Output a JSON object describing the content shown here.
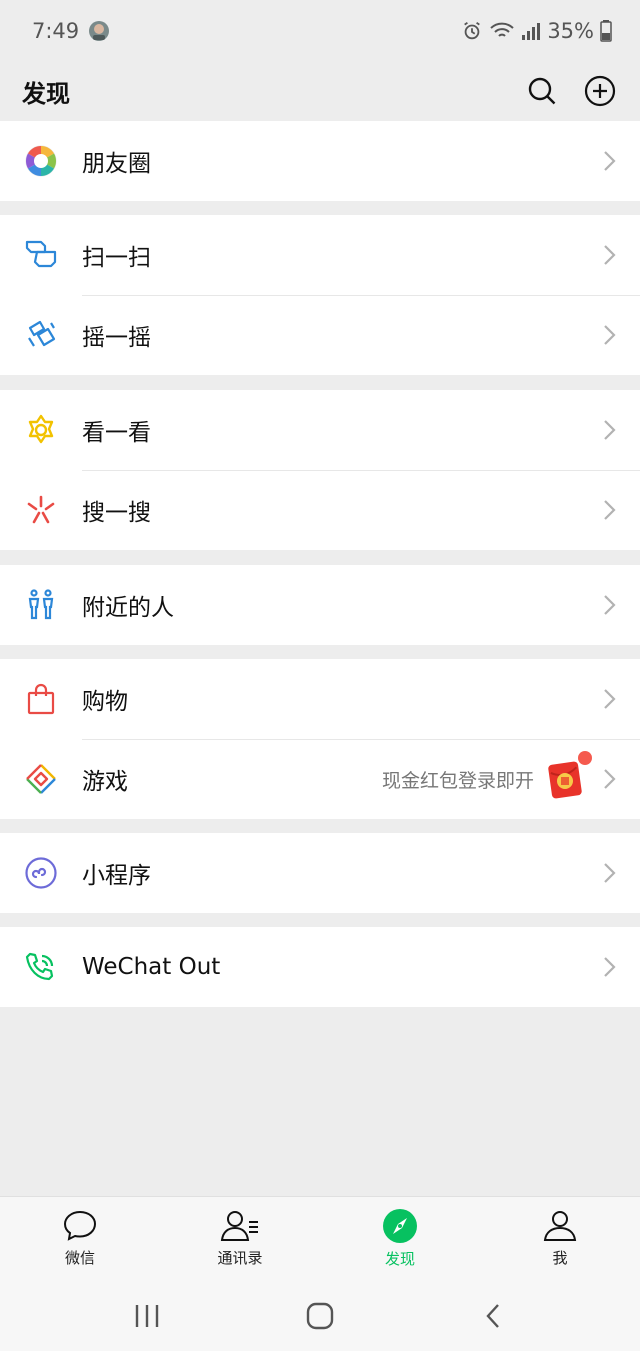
{
  "status": {
    "time": "7:49",
    "battery": "35%"
  },
  "header": {
    "title": "发现"
  },
  "groups": [
    [
      {
        "label": "朋友圈",
        "icon": "moments-aperture-icon"
      }
    ],
    [
      {
        "label": "扫一扫",
        "icon": "scan-icon"
      },
      {
        "label": "摇一摇",
        "icon": "shake-icon"
      }
    ],
    [
      {
        "label": "看一看",
        "icon": "top-stories-icon"
      },
      {
        "label": "搜一搜",
        "icon": "search-spark-icon"
      }
    ],
    [
      {
        "label": "附近的人",
        "icon": "people-nearby-icon"
      }
    ],
    [
      {
        "label": "购物",
        "icon": "shopping-bag-icon"
      },
      {
        "label": "游戏",
        "icon": "games-diamond-icon",
        "extra": "现金红包登录即开"
      }
    ],
    [
      {
        "label": "小程序",
        "icon": "mini-programs-icon"
      }
    ],
    [
      {
        "label": "WeChat Out",
        "icon": "wechat-out-phone-icon"
      }
    ]
  ],
  "tabs": [
    {
      "label": "微信",
      "icon": "chat-bubble-icon",
      "active": false
    },
    {
      "label": "通讯录",
      "icon": "contacts-icon",
      "active": false
    },
    {
      "label": "发现",
      "icon": "discover-compass-icon",
      "active": true
    },
    {
      "label": "我",
      "icon": "me-person-icon",
      "active": false
    }
  ],
  "colors": {
    "accent": "#07c160",
    "badge": "#f55a4e",
    "red_packet": "#e8332a"
  }
}
